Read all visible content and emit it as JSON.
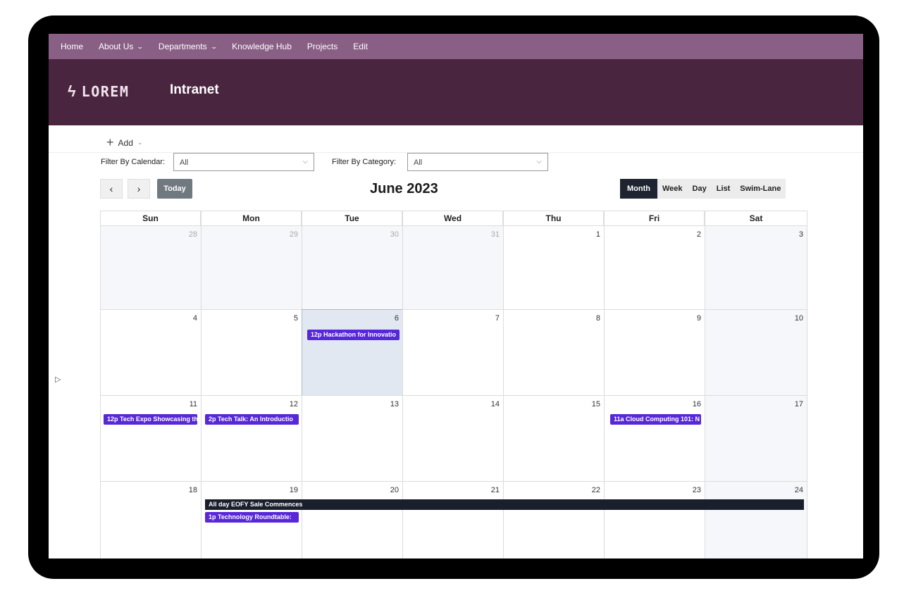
{
  "nav": {
    "items": [
      {
        "label": "Home",
        "has_menu": false
      },
      {
        "label": "About Us",
        "has_menu": true
      },
      {
        "label": "Departments",
        "has_menu": true
      },
      {
        "label": "Knowledge Hub",
        "has_menu": false
      },
      {
        "label": "Projects",
        "has_menu": false
      },
      {
        "label": "Edit",
        "has_menu": false
      }
    ]
  },
  "header": {
    "logo_icon": "lightning-bolt-icon",
    "logo_text": "LOREM",
    "site_title": "Intranet"
  },
  "toolbar": {
    "add_label": "Add",
    "filter_calendar_label": "Filter By Calendar:",
    "filter_calendar_value": "All",
    "filter_category_label": "Filter By Category:",
    "filter_category_value": "All",
    "prev_icon": "chevron-left-icon",
    "next_icon": "chevron-right-icon",
    "today_label": "Today",
    "month_title": "June 2023",
    "views": [
      "Month",
      "Week",
      "Day",
      "List",
      "Swim-Lane"
    ],
    "active_view": "Month"
  },
  "calendar": {
    "day_names": [
      "Sun",
      "Mon",
      "Tue",
      "Wed",
      "Thu",
      "Fri",
      "Sat"
    ],
    "weeks": [
      [
        "28",
        "29",
        "30",
        "31",
        "1",
        "2",
        "3"
      ],
      [
        "4",
        "5",
        "6",
        "7",
        "8",
        "9",
        "10"
      ],
      [
        "11",
        "12",
        "13",
        "14",
        "15",
        "16",
        "17"
      ],
      [
        "18",
        "19",
        "20",
        "21",
        "22",
        "23",
        "24"
      ]
    ],
    "events": {
      "w1_tue": "12p Hackathon for Innovatio",
      "w2_sun": "12p Tech Expo Showcasing th",
      "w2_mon": "2p Tech Talk: An Introductio",
      "w2_fri": "11a Cloud Computing 101: N",
      "w3_allday": "All day EOFY Sale Commences",
      "w3_mon": "1p Technology Roundtable:"
    }
  },
  "colors": {
    "nav_bg": "#8a5f85",
    "header_bg": "#4a2540",
    "event": "#5727d8",
    "allday_event": "#1a1f2c",
    "today_cell": "#e2e8f2"
  }
}
